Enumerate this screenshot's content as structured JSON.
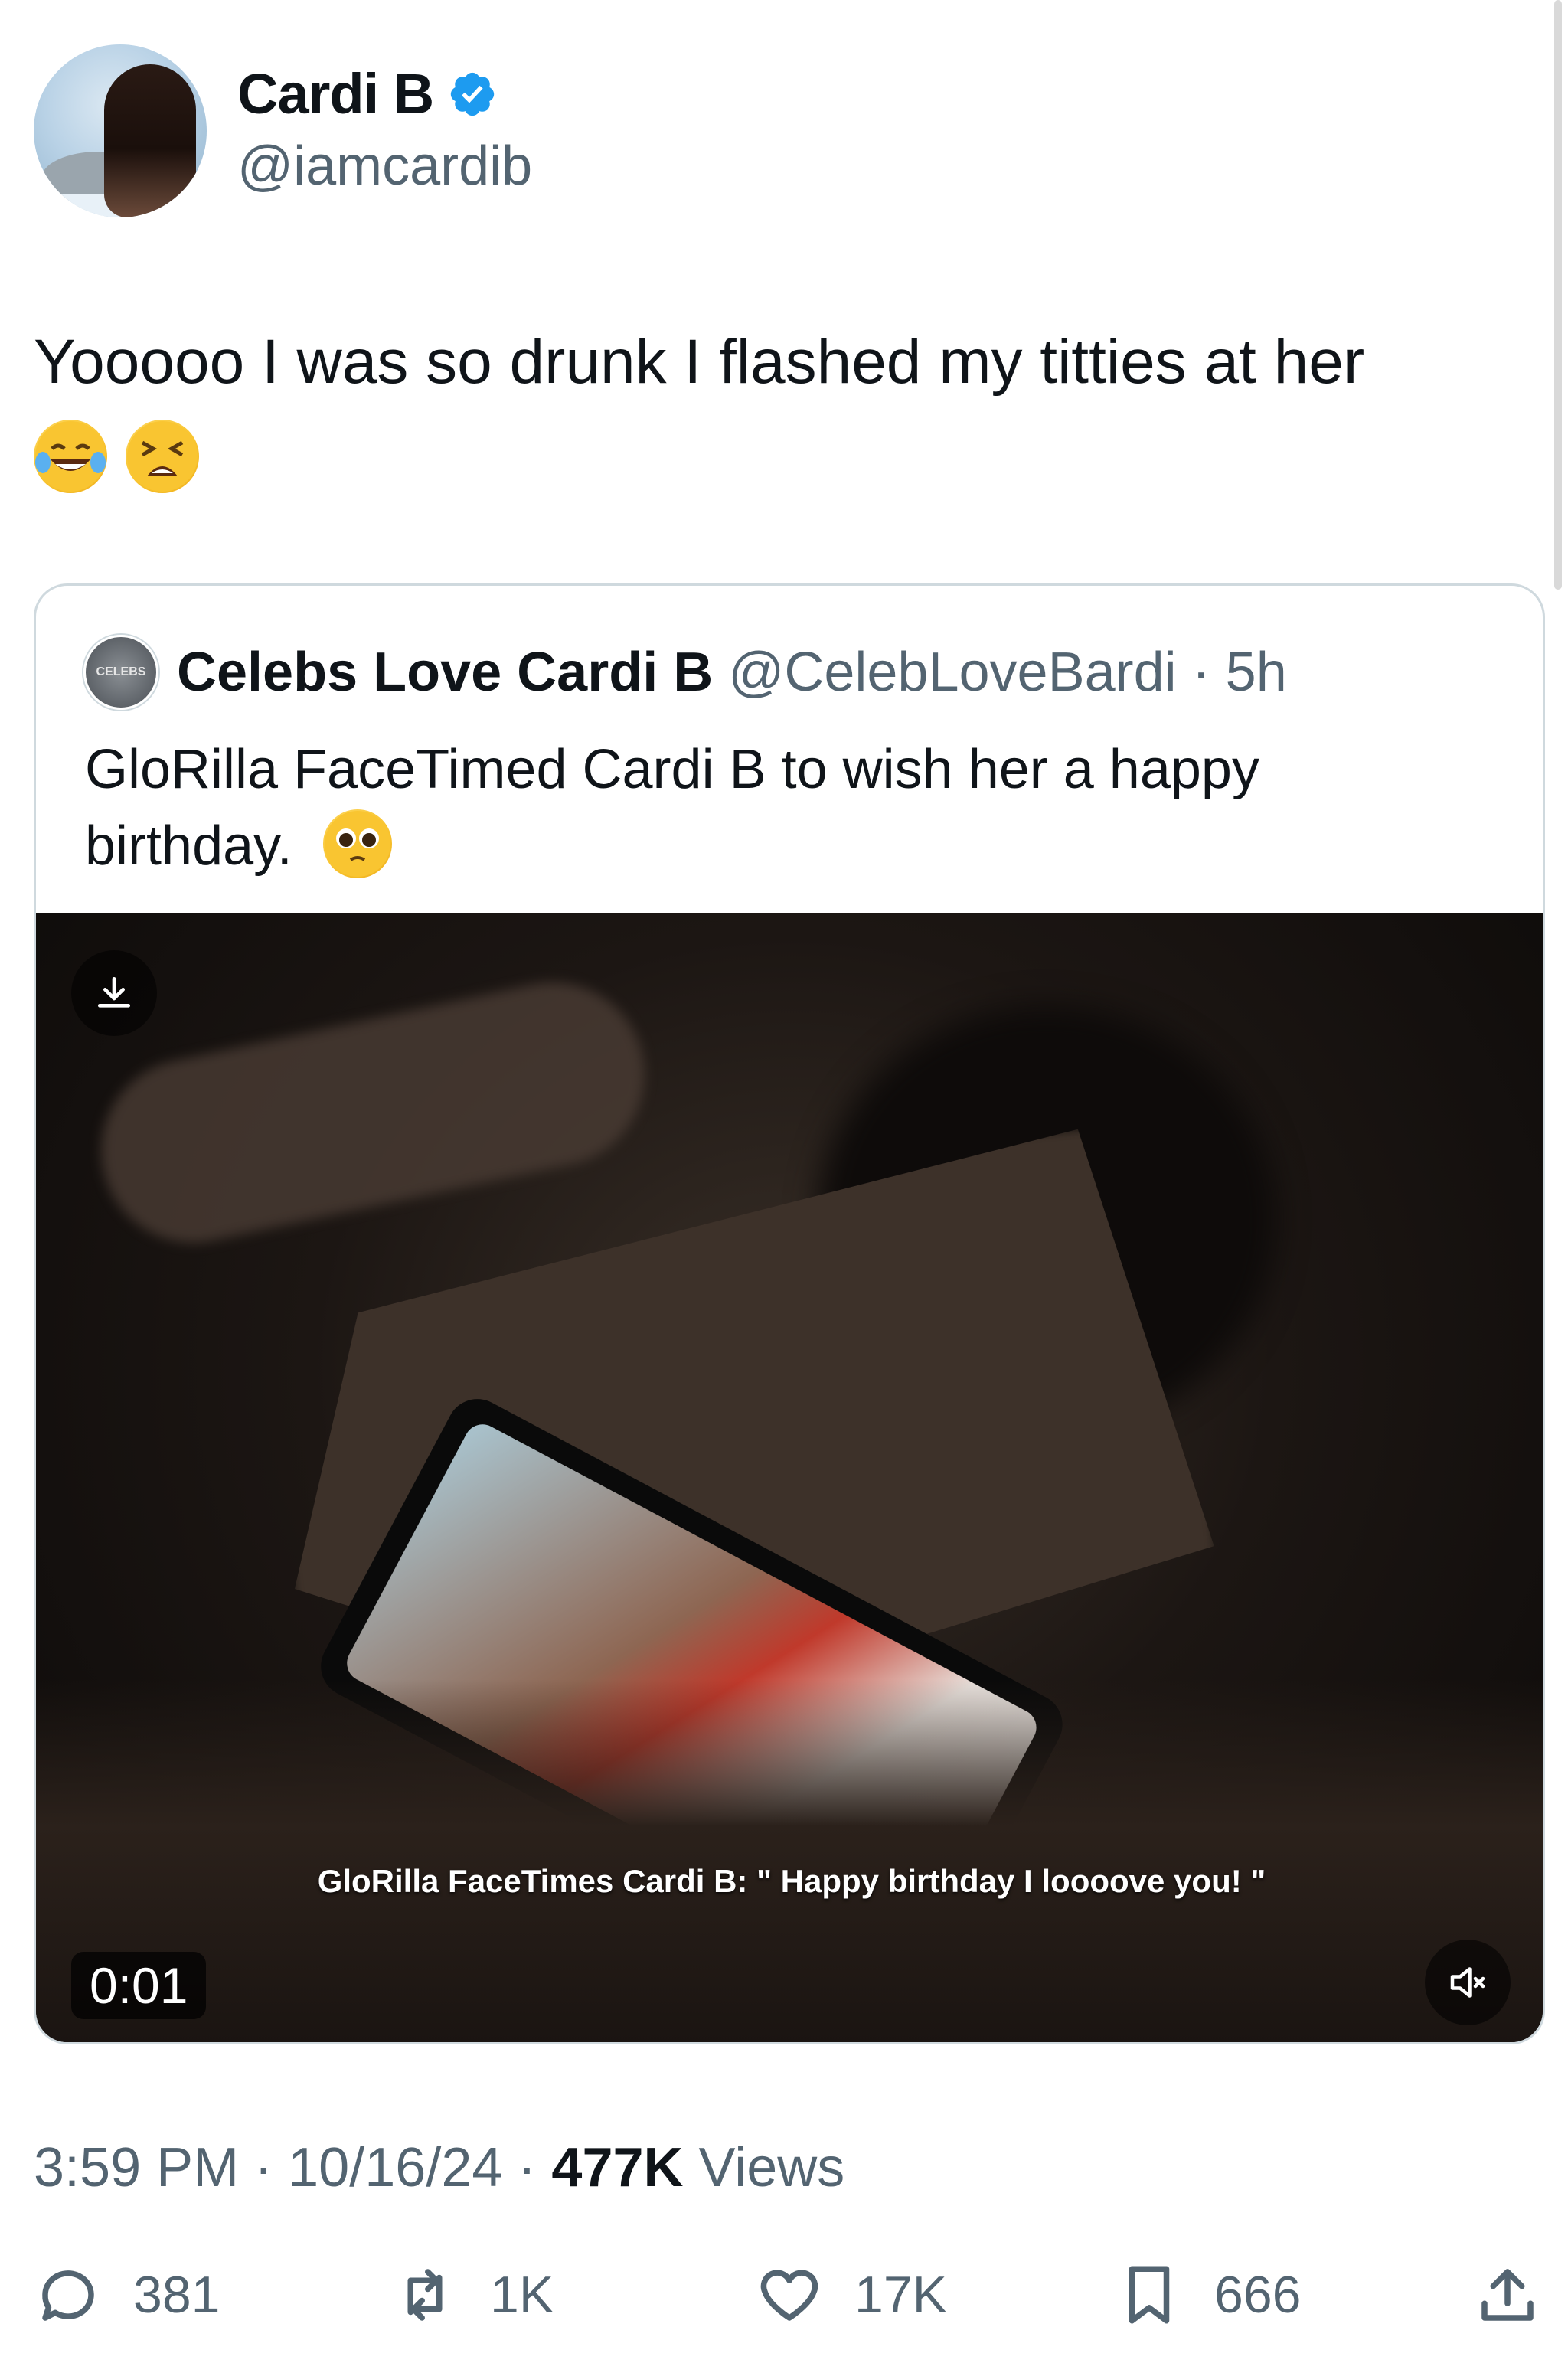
{
  "author": {
    "name": "Cardi B",
    "handle": "@iamcardib",
    "verified": true
  },
  "tweet": {
    "text": "Yooooo I was so drunk I flashed my titties at her",
    "emojis": [
      "face-with-tears-of-joy",
      "tired-face"
    ]
  },
  "quoted": {
    "avatar_text": "CELEBS",
    "name": "Celebs Love Cardi B",
    "handle": "@CelebLoveBardi",
    "time": "5h",
    "text": "GloRilla FaceTimed Cardi B to wish her a happy birthday.",
    "emoji": "pleading-face",
    "video": {
      "caption": "GloRilla FaceTimes Cardi B: \" Happy birthday I loooove you! \"",
      "timer": "0:01"
    }
  },
  "meta": {
    "time": "3:59 PM",
    "date": "10/16/24",
    "views_count": "477K",
    "views_label": "Views"
  },
  "actions": {
    "replies": "381",
    "reposts": "1K",
    "likes": "17K",
    "bookmarks": "666"
  },
  "colors": {
    "accent": "#1d9bf0",
    "text": "#0f1419",
    "secondary": "#536471",
    "border": "#cfd9de"
  }
}
